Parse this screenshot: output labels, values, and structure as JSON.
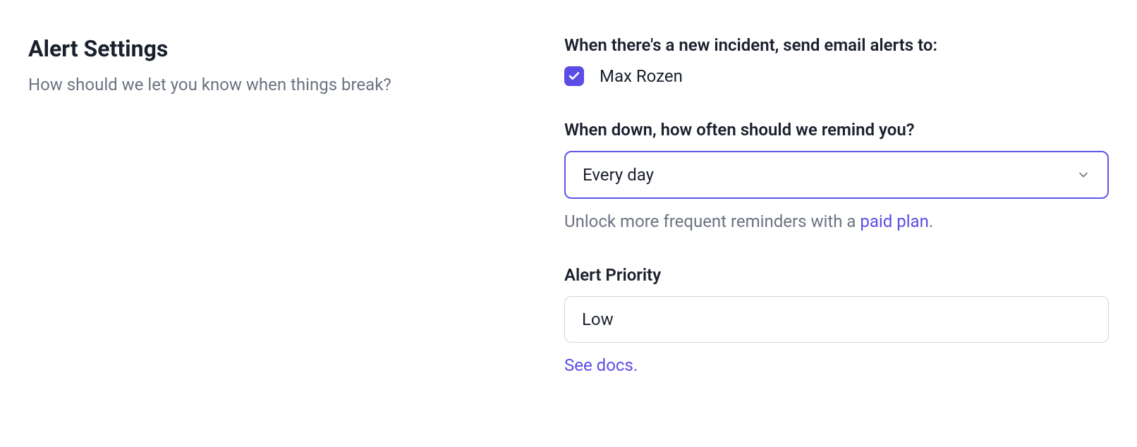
{
  "header": {
    "title": "Alert Settings",
    "subtitle": "How should we let you know when things break?"
  },
  "email_alerts": {
    "label": "When there's a new incident, send email alerts to:",
    "recipients": [
      {
        "name": "Max Rozen",
        "checked": true
      }
    ]
  },
  "reminder": {
    "label": "When down, how often should we remind you?",
    "selected": "Every day",
    "help_prefix": "Unlock more frequent reminders with a ",
    "help_link": "paid plan",
    "help_suffix": "."
  },
  "priority": {
    "label": "Alert Priority",
    "selected": "Low",
    "docs_link": "See docs",
    "docs_suffix": "."
  }
}
